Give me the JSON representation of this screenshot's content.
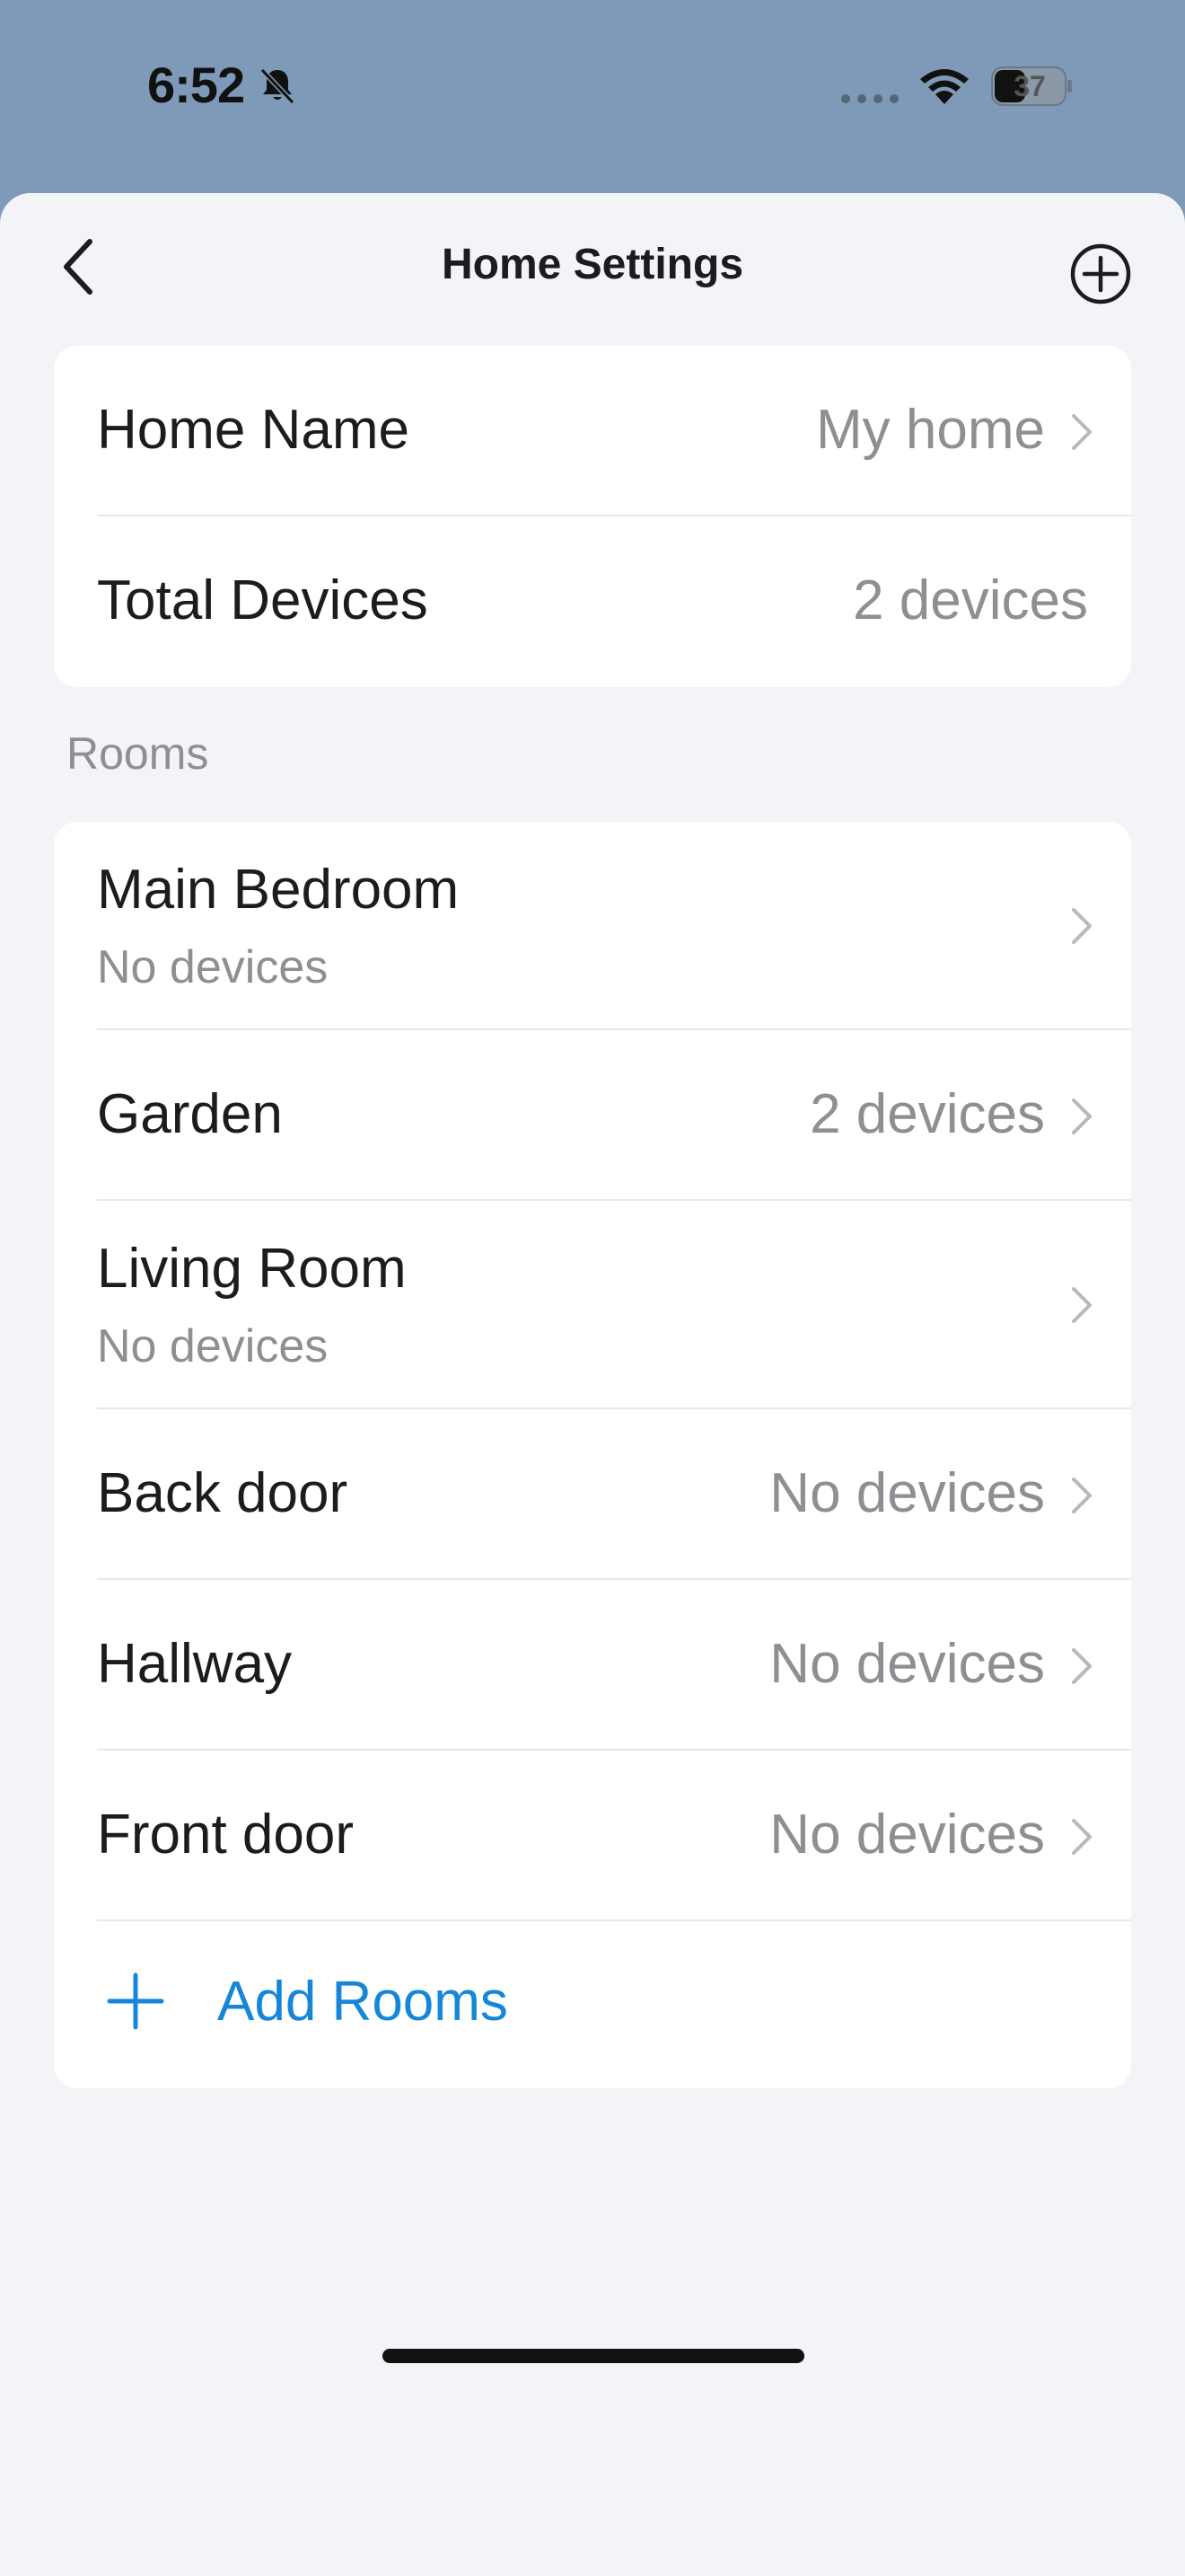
{
  "status_bar": {
    "time": "6:52",
    "battery": "37"
  },
  "nav": {
    "title": "Home Settings",
    "back_icon": "chevron-left-icon",
    "add_icon": "plus-circle-icon"
  },
  "home_info": {
    "name_label": "Home Name",
    "name_value": "My home",
    "devices_label": "Total Devices",
    "devices_value": "2 devices"
  },
  "rooms": {
    "section_label": "Rooms",
    "items": [
      {
        "name": "Main Bedroom",
        "devices": "No devices"
      },
      {
        "name": "Garden",
        "devices": "2 devices"
      },
      {
        "name": "Living Room",
        "devices": "No devices"
      },
      {
        "name": "Back door",
        "devices": "No devices"
      },
      {
        "name": "Hallway",
        "devices": "No devices"
      },
      {
        "name": "Front door",
        "devices": "No devices"
      }
    ],
    "add_label": "Add Rooms"
  },
  "colors": {
    "accent": "#1686d9",
    "background": "#f3f4f8",
    "secondary_text": "#8e8e93"
  }
}
